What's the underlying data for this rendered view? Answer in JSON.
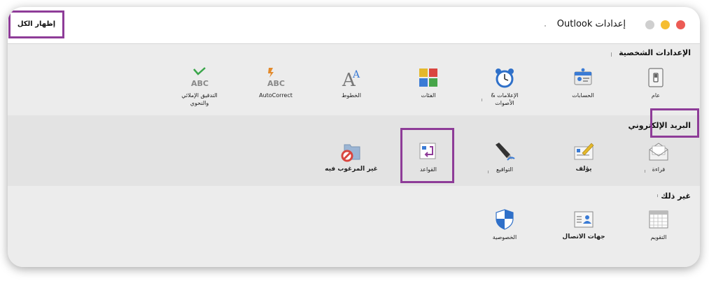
{
  "window": {
    "title": "إعدادات Outlook",
    "show_all_label": "إظهار الكل"
  },
  "sections": {
    "personal": {
      "title": "الإعدادات الشخصية",
      "items": [
        {
          "label": "عام",
          "icon": "switch-icon"
        },
        {
          "label": "الحسابات",
          "icon": "accounts-icon"
        },
        {
          "label": "الإعلامات & الأصوات",
          "icon": "alarm-clock-icon"
        },
        {
          "label": "الفئات",
          "icon": "categories-icon"
        },
        {
          "label": "الخطوط",
          "icon": "fonts-icon"
        },
        {
          "label": "AutoCorrect",
          "icon": "autocorrect-icon"
        },
        {
          "label": "التدقيق الإملائي والنحوي",
          "icon": "spelling-icon"
        }
      ]
    },
    "email": {
      "title": "البريد الإلكتروني",
      "items": [
        {
          "label": "قراءة",
          "icon": "envelope-icon"
        },
        {
          "label": "يؤلف",
          "icon": "compose-icon"
        },
        {
          "label": "التواقيع",
          "icon": "signature-pen-icon"
        },
        {
          "label": "القواعد",
          "icon": "rules-icon"
        },
        {
          "label": "غير المرغوب فيه",
          "icon": "junk-folder-icon"
        }
      ]
    },
    "other": {
      "title": "غير ذلك",
      "items": [
        {
          "label": "التقويم",
          "icon": "calendar-icon"
        },
        {
          "label": "جهات الاتصال",
          "icon": "contact-card-icon"
        },
        {
          "label": "الخصوصية",
          "icon": "shield-icon"
        }
      ]
    }
  },
  "colors": {
    "highlight": "#8e3c98",
    "close": "#ec5b54",
    "minimize": "#f5bd30",
    "zoom": "#cfcfcf"
  }
}
